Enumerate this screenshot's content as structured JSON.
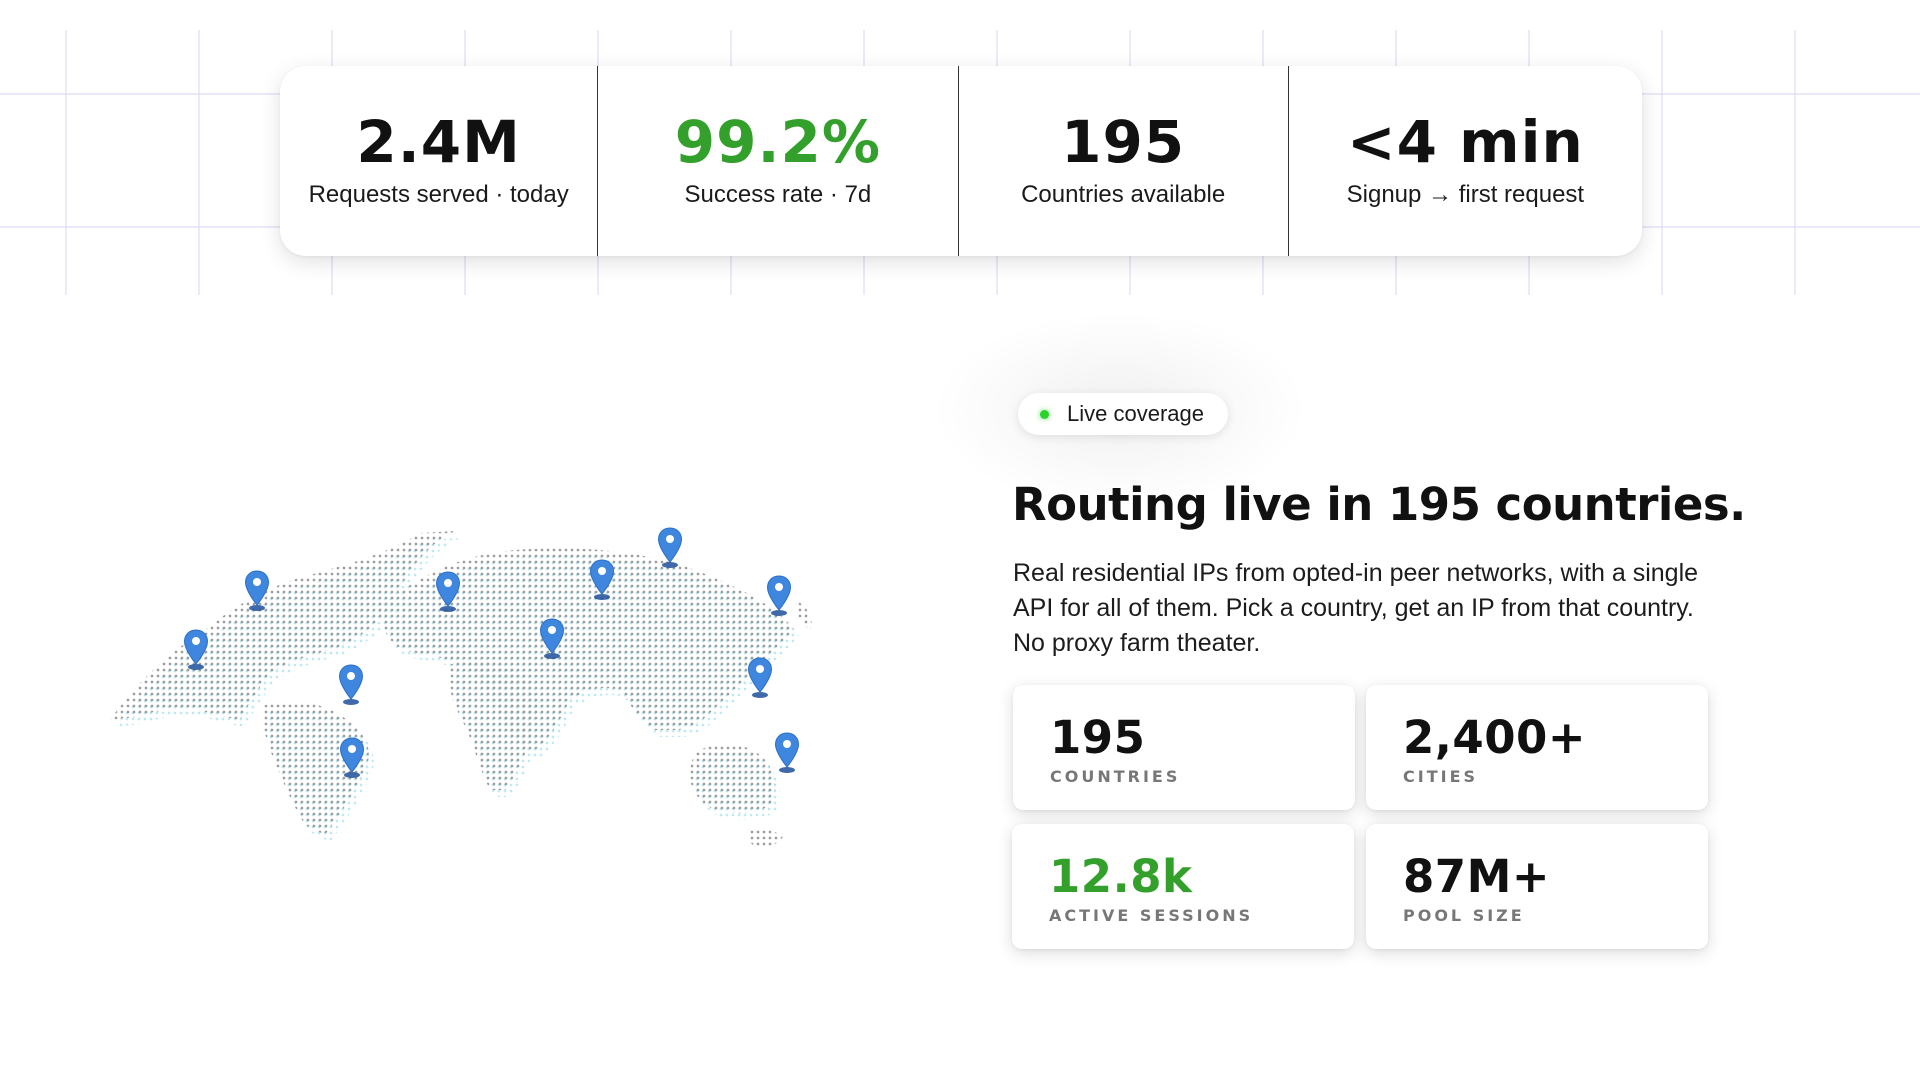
{
  "stats_bar": [
    {
      "value": "2.4M",
      "label": "Requests served · today",
      "color": "#111111"
    },
    {
      "value": "99.2%",
      "label": "Success rate · 7d",
      "color": "#33a02c"
    },
    {
      "value": "195",
      "label": "Countries available",
      "color": "#111111"
    },
    {
      "value": "<4 min",
      "label": "Signup → first request",
      "color": "#111111"
    }
  ],
  "coverage": {
    "badge": "Live coverage",
    "badge_dot_color": "#28d428",
    "headline": "Routing live in 195 countries.",
    "description": "Real residential IPs from opted-in peer networks, with a single API for all of them. Pick a country, get an IP from that country. No proxy farm theater."
  },
  "metrics": [
    {
      "value": "195",
      "label": "COUNTRIES"
    },
    {
      "value": "2,400+",
      "label": "CITIES"
    },
    {
      "value": "12.8k",
      "label": "ACTIVE SESSIONS"
    },
    {
      "value": "87M+",
      "label": "POOL SIZE"
    }
  ],
  "map": {
    "pin_icon": "location-pin-icon",
    "pin_color": "#3f86df",
    "pin_count": 12
  },
  "colors": {
    "accent_green": "#33a02c",
    "grid_line": "#d9d9f2"
  }
}
